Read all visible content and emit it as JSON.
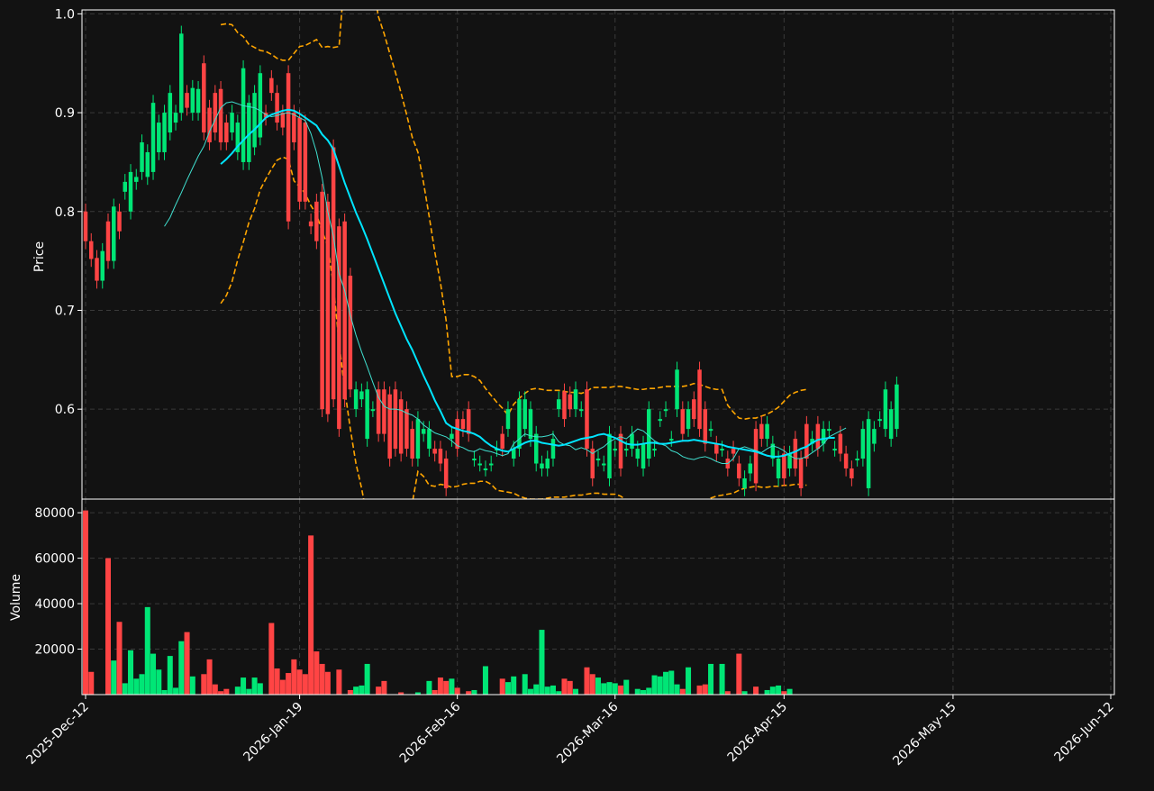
{
  "colors": {
    "background": "#121212",
    "up": "#00e676",
    "down": "#ff4444",
    "ma_short": "#40e0d0",
    "ma_long": "#00e5ff",
    "bands": "#ffa500",
    "grid": "#3a3a3a",
    "axis": "#ffffff"
  },
  "chart_data": [
    {
      "type": "candlestick",
      "panel": "price",
      "ylabel": "Price",
      "ylim": [
        0.509,
        1.004
      ],
      "yticks": [
        "0.6",
        "0.7",
        "0.8",
        "0.9",
        "1.0"
      ],
      "grid": true,
      "x_dates": [
        "2025-12-12",
        "2025-12-13",
        "2025-12-14",
        "2025-12-15",
        "2025-12-16",
        "2025-12-17",
        "2025-12-18",
        "2025-12-19",
        "2025-12-20",
        "2025-12-21",
        "2025-12-22",
        "2025-12-23",
        "2025-12-24",
        "2025-12-25",
        "2025-12-26",
        "2025-12-27",
        "2025-12-28",
        "2025-12-29",
        "2025-12-30",
        "2025-12-31",
        "2026-01-01",
        "2026-01-02",
        "2026-01-03",
        "2026-01-04",
        "2026-01-05",
        "2026-01-06",
        "2026-01-07",
        "2026-01-08",
        "2026-01-09",
        "2026-01-10",
        "2026-01-11",
        "2026-01-12",
        "2026-01-13",
        "2026-01-14",
        "2026-01-15",
        "2026-01-16",
        "2026-01-17",
        "2026-01-18",
        "2026-01-19",
        "2026-01-20",
        "2026-01-21",
        "2026-01-22",
        "2026-01-23",
        "2026-01-24",
        "2026-01-25",
        "2026-01-26",
        "2026-01-27",
        "2026-01-28",
        "2026-01-29",
        "2026-01-30",
        "2026-01-31",
        "2026-02-01",
        "2026-02-02",
        "2026-02-03",
        "2026-02-04",
        "2026-02-05",
        "2026-02-06",
        "2026-02-07",
        "2026-02-08",
        "2026-02-09",
        "2026-02-10",
        "2026-02-11",
        "2026-02-12",
        "2026-02-13",
        "2026-02-14",
        "2026-02-15",
        "2026-02-16",
        "2026-02-17",
        "2026-02-18",
        "2026-02-19",
        "2026-02-20",
        "2026-02-21",
        "2026-02-22",
        "2026-02-23",
        "2026-02-24",
        "2026-02-25",
        "2026-02-26",
        "2026-02-27",
        "2026-02-28",
        "2026-03-01",
        "2026-03-02",
        "2026-03-03",
        "2026-03-04",
        "2026-03-05",
        "2026-03-06",
        "2026-03-07",
        "2026-03-08",
        "2026-03-09",
        "2026-03-10",
        "2026-03-11",
        "2026-03-12",
        "2026-03-13",
        "2026-03-14",
        "2026-03-15",
        "2026-03-16",
        "2026-03-17",
        "2026-03-18",
        "2026-03-19",
        "2026-03-20",
        "2026-03-21",
        "2026-03-22",
        "2026-03-23",
        "2026-03-24",
        "2026-03-25",
        "2026-03-26",
        "2026-03-27",
        "2026-03-28",
        "2026-03-29",
        "2026-03-30",
        "2026-03-31",
        "2026-04-01",
        "2026-04-02",
        "2026-04-03",
        "2026-04-04",
        "2026-04-05",
        "2026-04-06",
        "2026-04-07",
        "2026-04-08",
        "2026-04-09",
        "2026-04-10",
        "2026-04-11",
        "2026-04-12",
        "2026-04-13",
        "2026-04-14",
        "2026-04-15",
        "2026-04-16",
        "2026-04-17",
        "2026-04-18",
        "2026-04-19",
        "2026-04-20",
        "2026-04-21",
        "2026-04-22",
        "2026-04-23",
        "2026-04-24",
        "2026-04-25",
        "2026-04-26",
        "2026-04-27",
        "2026-04-28",
        "2026-04-29",
        "2026-04-30",
        "2026-05-01",
        "2026-05-02",
        "2026-05-03",
        "2026-05-04",
        "2026-05-05",
        "2026-05-06",
        "2026-05-07",
        "2026-05-08",
        "2026-05-09",
        "2026-05-10",
        "2026-05-11",
        "2026-05-12",
        "2026-05-13",
        "2026-05-14",
        "2026-05-15",
        "2026-05-16",
        "2026-05-17",
        "2026-05-18",
        "2026-05-19",
        "2026-05-20",
        "2026-05-21",
        "2026-05-22",
        "2026-05-23",
        "2026-05-24",
        "2026-05-25",
        "2026-05-26",
        "2026-05-27",
        "2026-05-28",
        "2026-05-29",
        "2026-05-30",
        "2026-05-31",
        "2026-06-01",
        "2026-06-02",
        "2026-06-03",
        "2026-06-04",
        "2026-06-05",
        "2026-06-06",
        "2026-06-07",
        "2026-06-08",
        "2026-06-09",
        "2026-06-10",
        "2026-06-11",
        "2026-06-12"
      ],
      "open": [
        0.8,
        0.77,
        0.753,
        0.73,
        0.79,
        0.75,
        0.8,
        0.82,
        0.8,
        0.83,
        0.84,
        0.835,
        0.84,
        0.86,
        0.86,
        0.88,
        0.89,
        0.9,
        0.92,
        0.9,
        0.9,
        0.95,
        0.905,
        0.92,
        0.924,
        0.89,
        0.88,
        0.86,
        0.85,
        0.85,
        0.865,
        0.875,
        0.9,
        0.935,
        0.92,
        0.9,
        0.94,
        0.9,
        0.895,
        0.89,
        0.79,
        0.81,
        0.82,
        0.81,
        0.865,
        0.785,
        0.79,
        0.735,
        0.6,
        0.61,
        0.57,
        0.6,
        0.62,
        0.62,
        0.615,
        0.62,
        0.61,
        0.6,
        0.58,
        0.55,
        0.575,
        0.56,
        0.56,
        0.56,
        0.55,
        0.57,
        0.59,
        0.59,
        0.6,
        0.55,
        0.545,
        0.54,
        0.545,
        0.56,
        0.575,
        0.58,
        0.55,
        0.56,
        0.58,
        0.57,
        0.545,
        0.54,
        0.54,
        0.55,
        0.6,
        0.618,
        0.615,
        0.6,
        0.6,
        0.62,
        0.56,
        0.55,
        0.545,
        0.53,
        0.56,
        0.575,
        0.56,
        0.56,
        0.55,
        0.54,
        0.55,
        0.56,
        0.59,
        0.6,
        0.57,
        0.6,
        0.6,
        0.58,
        0.61,
        0.64,
        0.6,
        0.58,
        0.565,
        0.56,
        0.55,
        0.56,
        0.545,
        0.52,
        0.535,
        0.58,
        0.585,
        0.57,
        0.55,
        0.53,
        0.555,
        0.54,
        0.57,
        0.55,
        0.585,
        0.565,
        0.585,
        0.565,
        0.58,
        0.56,
        0.575,
        0.555,
        0.54,
        0.55,
        0.55,
        0.52,
        0.565,
        0.59,
        0.58,
        0.57,
        0.58
      ],
      "close": [
        0.77,
        0.752,
        0.73,
        0.76,
        0.75,
        0.805,
        0.78,
        0.83,
        0.84,
        0.835,
        0.87,
        0.86,
        0.91,
        0.89,
        0.9,
        0.92,
        0.9,
        0.98,
        0.905,
        0.925,
        0.924,
        0.88,
        0.87,
        0.88,
        0.87,
        0.87,
        0.9,
        0.89,
        0.945,
        0.91,
        0.92,
        0.94,
        0.895,
        0.92,
        0.89,
        0.885,
        0.79,
        0.87,
        0.81,
        0.81,
        0.785,
        0.77,
        0.6,
        0.595,
        0.61,
        0.58,
        0.61,
        0.62,
        0.62,
        0.618,
        0.62,
        0.6,
        0.575,
        0.575,
        0.55,
        0.56,
        0.555,
        0.56,
        0.55,
        0.59,
        0.58,
        0.58,
        0.555,
        0.545,
        0.52,
        0.575,
        0.56,
        0.58,
        0.575,
        0.55,
        0.545,
        0.54,
        0.545,
        0.56,
        0.56,
        0.6,
        0.56,
        0.61,
        0.61,
        0.6,
        0.575,
        0.545,
        0.55,
        0.57,
        0.61,
        0.59,
        0.6,
        0.62,
        0.6,
        0.56,
        0.53,
        0.55,
        0.545,
        0.575,
        0.56,
        0.54,
        0.56,
        0.575,
        0.56,
        0.565,
        0.6,
        0.56,
        0.59,
        0.6,
        0.57,
        0.64,
        0.575,
        0.6,
        0.59,
        0.58,
        0.565,
        0.58,
        0.555,
        0.56,
        0.54,
        0.555,
        0.53,
        0.53,
        0.545,
        0.525,
        0.57,
        0.585,
        0.565,
        0.55,
        0.53,
        0.555,
        0.54,
        0.52,
        0.55,
        0.57,
        0.56,
        0.58,
        0.58,
        0.56,
        0.555,
        0.54,
        0.53,
        0.55,
        0.58,
        0.59,
        0.58,
        0.59,
        0.62,
        0.6,
        0.625
      ]
    },
    {
      "type": "line",
      "panel": "price",
      "series": [
        {
          "style": "solid-thin",
          "color": "ma_short",
          "start_date": "2025-12-26",
          "values": [
            0.785,
            0.794,
            0.807,
            0.819,
            0.832,
            0.844,
            0.856,
            0.866,
            0.881,
            0.893,
            0.905,
            0.91,
            0.911,
            0.909,
            0.907,
            0.906,
            0.905,
            0.902,
            0.898,
            0.896,
            0.897,
            0.899,
            0.9,
            0.898,
            0.895,
            0.892,
            0.879,
            0.86,
            0.834,
            0.8,
            0.775,
            0.737,
            0.72,
            0.695,
            0.675,
            0.658,
            0.643,
            0.627,
            0.612,
            0.603,
            0.6,
            0.6,
            0.599,
            0.596,
            0.594,
            0.59,
            0.584,
            0.58,
            0.576,
            0.574,
            0.572,
            0.568,
            0.563,
            0.561,
            0.558,
            0.557,
            0.56,
            0.558,
            0.557,
            0.555,
            0.553,
            0.555,
            0.565,
            0.57,
            0.575,
            0.573,
            0.572,
            0.572,
            0.573,
            0.575,
            0.567,
            0.564,
            0.563,
            0.559,
            0.561,
            0.559,
            0.555,
            0.559,
            0.562,
            0.567,
            0.57,
            0.572,
            0.57,
            0.575,
            0.58,
            0.578,
            0.573,
            0.568,
            0.565,
            0.563,
            0.558,
            0.556,
            0.552,
            0.55,
            0.549,
            0.551,
            0.552,
            0.55,
            0.547,
            0.545,
            0.545,
            0.55,
            0.56,
            0.562,
            0.56,
            0.558,
            0.556,
            0.56,
            0.563,
            0.561,
            0.558,
            0.553,
            0.55,
            0.55,
            0.552,
            0.556,
            0.56,
            0.565,
            0.572,
            0.575,
            0.578,
            0.581
          ]
        },
        {
          "style": "solid-thick",
          "color": "ma_long",
          "start_date": "2026-01-05",
          "values": [
            0.848,
            0.853,
            0.859,
            0.866,
            0.872,
            0.878,
            0.883,
            0.889,
            0.895,
            0.898,
            0.9,
            0.902,
            0.903,
            0.902,
            0.899,
            0.895,
            0.891,
            0.887,
            0.878,
            0.872,
            0.863,
            0.846,
            0.829,
            0.814,
            0.799,
            0.786,
            0.772,
            0.757,
            0.742,
            0.727,
            0.712,
            0.697,
            0.684,
            0.671,
            0.66,
            0.647,
            0.634,
            0.622,
            0.609,
            0.598,
            0.586,
            0.582,
            0.58,
            0.578,
            0.577,
            0.575,
            0.572,
            0.567,
            0.563,
            0.56,
            0.558,
            0.557,
            0.56,
            0.563,
            0.566,
            0.568,
            0.568,
            0.566,
            0.565,
            0.564,
            0.563,
            0.564,
            0.566,
            0.568,
            0.57,
            0.571,
            0.572,
            0.574,
            0.575,
            0.573,
            0.571,
            0.568,
            0.565,
            0.564,
            0.564,
            0.565,
            0.566,
            0.566,
            0.565,
            0.565,
            0.566,
            0.567,
            0.568,
            0.568,
            0.569,
            0.568,
            0.567,
            0.566,
            0.565,
            0.564,
            0.562,
            0.561,
            0.56,
            0.559,
            0.558,
            0.557,
            0.555,
            0.553,
            0.552,
            0.552,
            0.553,
            0.555,
            0.557,
            0.56,
            0.562,
            0.566,
            0.569,
            0.57,
            0.571,
            0.571
          ]
        },
        {
          "style": "dashed",
          "color": "bands",
          "name_key": "upper",
          "start_date": "2026-01-05",
          "values": [
            0.989,
            0.99,
            0.989,
            0.981,
            0.977,
            0.969,
            0.966,
            0.963,
            0.962,
            0.959,
            0.955,
            0.953,
            0.953,
            0.96,
            0.967,
            0.968,
            0.971,
            0.974,
            0.966,
            0.967,
            0.966,
            0.967,
            1.04,
            1.08,
            1.1,
            1.09,
            1.06,
            1.03,
            0.997,
            0.98,
            0.96,
            0.941,
            0.92,
            0.898,
            0.875,
            0.86,
            0.829,
            0.795,
            0.759,
            0.728,
            0.69,
            0.633,
            0.633,
            0.635,
            0.635,
            0.633,
            0.629,
            0.621,
            0.614,
            0.607,
            0.601,
            0.594,
            0.605,
            0.611,
            0.616,
            0.62,
            0.621,
            0.62,
            0.619,
            0.619,
            0.619,
            0.618,
            0.617,
            0.617,
            0.616,
            0.618,
            0.622,
            0.622,
            0.622,
            0.622,
            0.623,
            0.623,
            0.622,
            0.621,
            0.62,
            0.62,
            0.621,
            0.621,
            0.622,
            0.623,
            0.623,
            0.623,
            0.623,
            0.624,
            0.626,
            0.625,
            0.623,
            0.621,
            0.62,
            0.62,
            0.604,
            0.597,
            0.591,
            0.59,
            0.591,
            0.591,
            0.593,
            0.595,
            0.598,
            0.602,
            0.608,
            0.614,
            0.617,
            0.619,
            0.62
          ]
        },
        {
          "style": "dashed",
          "color": "bands",
          "name_key": "lower",
          "start_date": "2026-01-05",
          "values": [
            0.707,
            0.715,
            0.729,
            0.751,
            0.769,
            0.789,
            0.803,
            0.822,
            0.833,
            0.843,
            0.852,
            0.855,
            0.853,
            0.831,
            0.825,
            0.818,
            0.806,
            0.797,
            0.78,
            0.765,
            0.725,
            0.667,
            0.62,
            0.58,
            0.545,
            0.52,
            0.49,
            0.46,
            0.44,
            0.43,
            0.41,
            0.42,
            0.45,
            0.48,
            0.505,
            0.537,
            0.532,
            0.523,
            0.522,
            0.524,
            0.523,
            0.521,
            0.522,
            0.524,
            0.525,
            0.525,
            0.527,
            0.527,
            0.524,
            0.518,
            0.517,
            0.516,
            0.515,
            0.512,
            0.51,
            0.509,
            0.509,
            0.509,
            0.51,
            0.511,
            0.511,
            0.511,
            0.512,
            0.513,
            0.513,
            0.514,
            0.515,
            0.515,
            0.514,
            0.514,
            0.514,
            0.512,
            0.508,
            0.505,
            0.503,
            0.503,
            0.505,
            0.505,
            0.505,
            0.506,
            0.507,
            0.508,
            0.508,
            0.508,
            0.507,
            0.505,
            0.506,
            0.51,
            0.512,
            0.513,
            0.514,
            0.515,
            0.518,
            0.52,
            0.521,
            0.522,
            0.521,
            0.521,
            0.522,
            0.522,
            0.523,
            0.523,
            0.524,
            0.524,
            0.523
          ]
        }
      ]
    },
    {
      "type": "bar",
      "panel": "volume",
      "ylabel": "Volume",
      "ylim": [
        0,
        86000
      ],
      "yticks": [
        "20000",
        "40000",
        "60000",
        "80000"
      ],
      "grid": true,
      "xlabels": [
        "2025-Dec-12",
        "2026-Jan-19",
        "2026-Feb-16",
        "2026-Mar-16",
        "2026-Apr-15",
        "2026-May-15",
        "2026-Jun-12"
      ],
      "values": [
        81000,
        10000,
        0,
        0,
        60000,
        15000,
        32000,
        5000,
        19500,
        7000,
        9000,
        38500,
        18000,
        11000,
        2000,
        17000,
        3000,
        23500,
        27500,
        8000,
        0,
        9000,
        15500,
        4500,
        1500,
        2500,
        0,
        3500,
        7500,
        2500,
        7500,
        5000,
        0,
        31500,
        11500,
        6500,
        9500,
        15500,
        11000,
        9000,
        70000,
        19000,
        13500,
        10000,
        0,
        11000,
        0,
        2000,
        3500,
        4000,
        13500,
        0,
        3500,
        6000,
        0,
        0,
        1000,
        0,
        0,
        1000,
        0,
        6000,
        2000,
        7500,
        6000,
        7000,
        3000,
        0,
        1500,
        2000,
        0,
        12500,
        0,
        0,
        7000,
        5500,
        8000,
        0,
        9000,
        2500,
        4500,
        28500,
        3500,
        4000,
        1500,
        7000,
        6000,
        2500,
        0,
        12000,
        9000,
        7500,
        5000,
        5500,
        5000,
        4000,
        6500,
        0,
        2500,
        2000,
        3000,
        8500,
        8000,
        10000,
        10500,
        4500,
        2500,
        12000,
        0,
        4000,
        4500,
        13500,
        0,
        13500,
        1500,
        0,
        18000,
        1500,
        0,
        3500,
        0,
        2000,
        3500,
        4000,
        1500,
        2500
      ]
    }
  ]
}
